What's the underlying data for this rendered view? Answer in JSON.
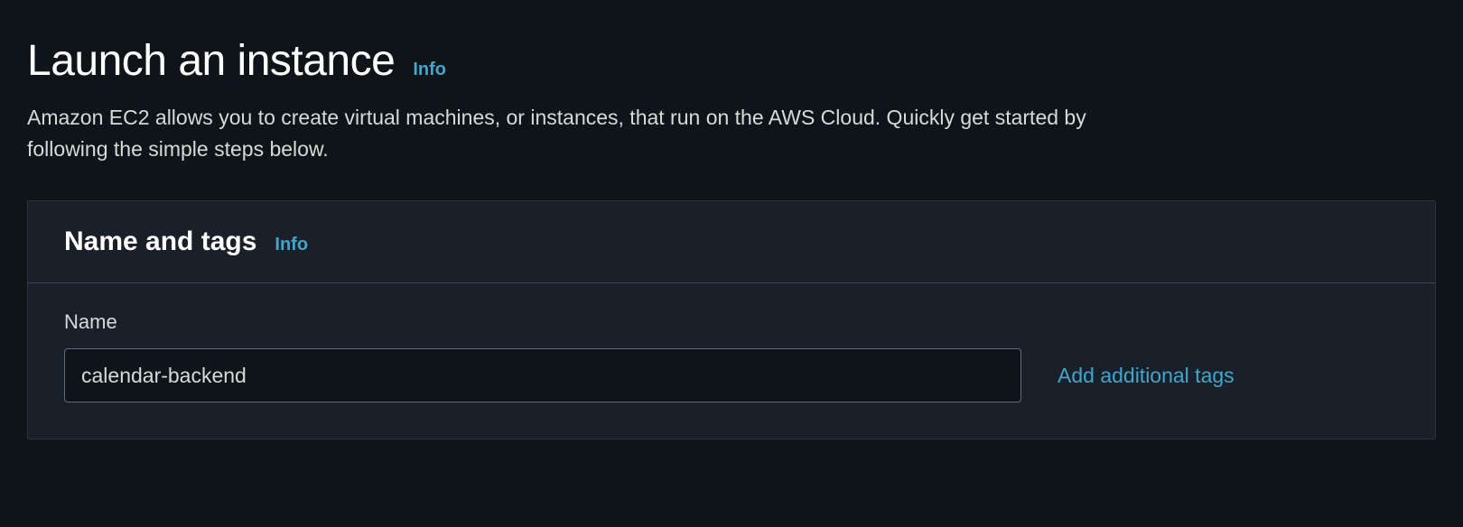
{
  "header": {
    "title": "Launch an instance",
    "info_label": "Info",
    "description": "Amazon EC2 allows you to create virtual machines, or instances, that run on the AWS Cloud. Quickly get started by following the simple steps below."
  },
  "name_and_tags": {
    "panel_title": "Name and tags",
    "info_label": "Info",
    "name_field_label": "Name",
    "name_value": "calendar-backend",
    "add_tags_label": "Add additional tags"
  }
}
